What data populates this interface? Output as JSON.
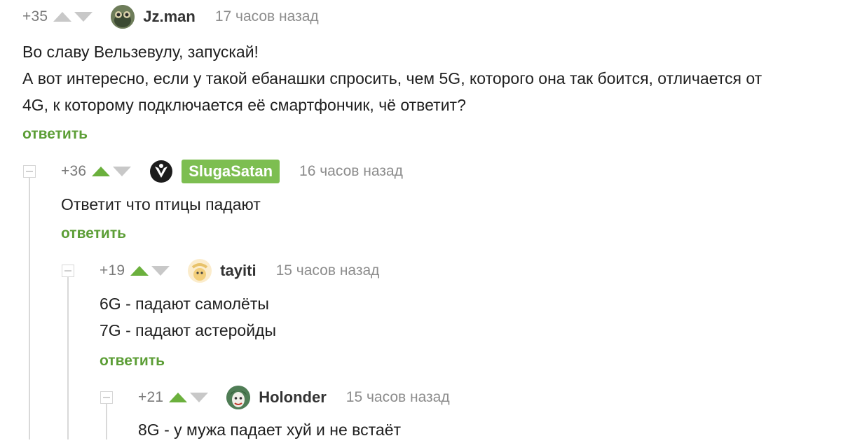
{
  "comments": [
    {
      "rating": "+35",
      "username": "Jz.man",
      "time": "17 часов назад",
      "lines": [
        "Во славу Вельзевулу, запускай!",
        "А вот интересно, если у такой ебанашки спросить, чем 5G, которого она так боится, отличается от",
        "4G, к которому подключается её смартфончик, чё ответит?"
      ],
      "reply": "ответить"
    },
    {
      "rating": "+36",
      "username": "SlugaSatan",
      "time": "16 часов назад",
      "lines": [
        "Ответит что птицы падают"
      ],
      "reply": "ответить"
    },
    {
      "rating": "+19",
      "username": "tayiti",
      "time": "15 часов назад",
      "lines": [
        "6G - падают самолёты",
        "7G - падают астеройды"
      ],
      "reply": "ответить"
    },
    {
      "rating": "+21",
      "username": "Holonder",
      "time": "15 часов назад",
      "lines": [
        "8G - у мужа падает хуй и не встаёт"
      ],
      "reply": ""
    }
  ],
  "colors": {
    "upvote_active": "#6bb03d",
    "arrow_inactive": "#c8c8c8",
    "reply_link": "#5c9e36",
    "op_badge": "#7dbe51"
  },
  "icons": {
    "upvote": "triangle-up-icon",
    "downvote": "triangle-down-icon",
    "collapse": "minus-box-icon"
  }
}
